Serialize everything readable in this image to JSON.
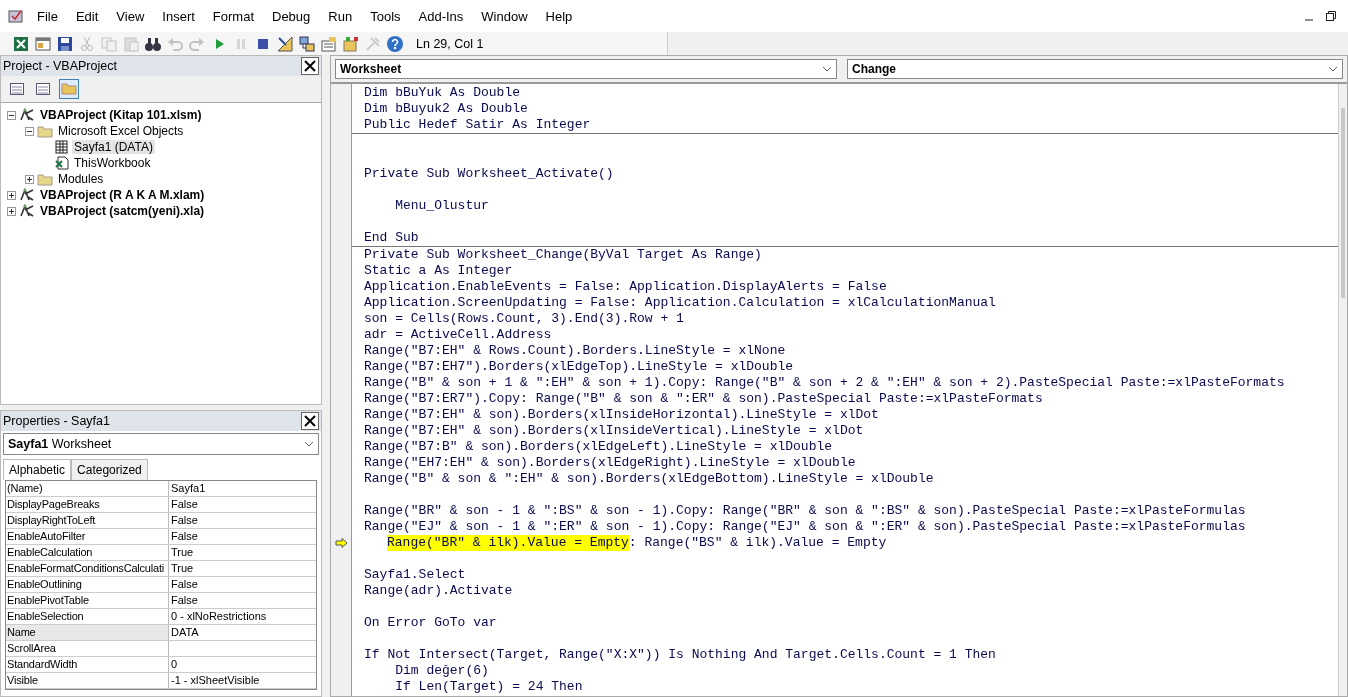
{
  "menu": [
    "File",
    "Edit",
    "View",
    "Insert",
    "Format",
    "Debug",
    "Run",
    "Tools",
    "Add-Ins",
    "Window",
    "Help"
  ],
  "toolbar": [
    {
      "kind": "excel",
      "disabled": false
    },
    {
      "kind": "insert",
      "disabled": false
    },
    {
      "kind": "save",
      "disabled": false
    },
    {
      "kind": "cut",
      "disabled": true
    },
    {
      "kind": "copy",
      "disabled": true
    },
    {
      "kind": "paste",
      "disabled": true
    },
    {
      "kind": "find",
      "disabled": false
    },
    {
      "kind": "undo",
      "disabled": true
    },
    {
      "kind": "redo",
      "disabled": true
    },
    {
      "kind": "run",
      "disabled": false
    },
    {
      "kind": "pause",
      "disabled": true
    },
    {
      "kind": "stop",
      "disabled": false
    },
    {
      "kind": "design",
      "disabled": false
    },
    {
      "kind": "explorer",
      "disabled": false
    },
    {
      "kind": "properties",
      "disabled": false
    },
    {
      "kind": "browser",
      "disabled": false
    },
    {
      "kind": "toolbox",
      "disabled": true
    },
    {
      "kind": "help",
      "disabled": false
    }
  ],
  "status": "Ln 29, Col 1",
  "project": {
    "title": "Project - VBAProject",
    "buttons": [
      {
        "kind": "code",
        "selected": false
      },
      {
        "kind": "object",
        "selected": false
      },
      {
        "kind": "folders",
        "selected": true
      }
    ],
    "tree": [
      {
        "kind": "project",
        "label": "VBAProject (Kitap 101.xlsm)",
        "expanded": true,
        "children": [
          {
            "kind": "folder",
            "label": "Microsoft Excel Objects",
            "expanded": true,
            "children": [
              {
                "kind": "sheet",
                "label": "Sayfa1 (DATA)",
                "selected": true
              },
              {
                "kind": "workbook",
                "label": "ThisWorkbook",
                "selected": false
              }
            ]
          },
          {
            "kind": "folder",
            "label": "Modules",
            "expanded": false
          }
        ]
      },
      {
        "kind": "project",
        "label": "VBAProject (R A K A M.xlam)",
        "expanded": false
      },
      {
        "kind": "project",
        "label": "VBAProject (satcm(yeni).xla)",
        "expanded": false
      }
    ]
  },
  "properties": {
    "title": "Properties - Sayfa1",
    "object": "**Sayfa1** Worksheet",
    "tabs": [
      {
        "label": "Alphabetic",
        "selected": true
      },
      {
        "label": "Categorized",
        "selected": false
      }
    ],
    "rows": [
      {
        "name": "(Name)",
        "value": "Sayfa1",
        "selected": false
      },
      {
        "name": "DisplayPageBreaks",
        "value": "False",
        "selected": false
      },
      {
        "name": "DisplayRightToLeft",
        "value": "False",
        "selected": false
      },
      {
        "name": "EnableAutoFilter",
        "value": "False",
        "selected": false
      },
      {
        "name": "EnableCalculation",
        "value": "True",
        "selected": false
      },
      {
        "name": "EnableFormatConditionsCalculati",
        "value": "True",
        "selected": false
      },
      {
        "name": "EnableOutlining",
        "value": "False",
        "selected": false
      },
      {
        "name": "EnablePivotTable",
        "value": "False",
        "selected": false
      },
      {
        "name": "EnableSelection",
        "value": "0 - xlNoRestrictions",
        "selected": false
      },
      {
        "name": "Name",
        "value": "DATA",
        "selected": true
      },
      {
        "name": "ScrollArea",
        "selected": false
      },
      {
        "name": "StandardWidth",
        "value": "0",
        "selected": false
      },
      {
        "name": "Visible",
        "value": "-1 - xlSheetVisible",
        "selected": false
      }
    ]
  },
  "code": {
    "object": "Worksheet",
    "procedure": "Change",
    "blocks": [
      {
        "lines": [
          {
            "kind": "code",
            "text": "Dim bBuYuk As Double"
          },
          {
            "kind": "code",
            "text": "Dim bBuyuk2 As Double"
          },
          {
            "kind": "code",
            "text": "Public Hedef Satir As Integer"
          }
        ]
      },
      {
        "lines": [
          {
            "kind": "blank"
          },
          {
            "kind": "blank"
          },
          {
            "kind": "code",
            "text": "Private Sub Worksheet_Activate()"
          },
          {
            "kind": "blank"
          },
          {
            "kind": "code",
            "text": "    Menu_Olustur"
          },
          {
            "kind": "blank"
          },
          {
            "kind": "code",
            "text": "End Sub"
          }
        ]
      },
      {
        "lines": [
          {
            "kind": "code",
            "text": "Private Sub Worksheet_Change(ByVal Target As Range)"
          },
          {
            "kind": "code",
            "text": "Static a As Integer"
          },
          {
            "kind": "code",
            "text": "Application.EnableEvents = False: Application.DisplayAlerts = False"
          },
          {
            "kind": "code",
            "text": "Application.ScreenUpdating = False: Application.Calculation = xlCalculationManual"
          },
          {
            "kind": "code",
            "text": "son = Cells(Rows.Count, 3).End(3).Row + 1"
          },
          {
            "kind": "code",
            "text": "adr = ActiveCell.Address"
          },
          {
            "kind": "code",
            "text": "Range(\"B7:EH\" & Rows.Count).Borders.LineStyle = xlNone"
          },
          {
            "kind": "code",
            "text": "Range(\"B7:EH7\").Borders(xlEdgeTop).LineStyle = xlDouble"
          },
          {
            "kind": "code",
            "text": "Range(\"B\" & son + 1 & \":EH\" & son + 1).Copy: Range(\"B\" & son + 2 & \":EH\" & son + 2).PasteSpecial Paste:=xlPasteFormats"
          },
          {
            "kind": "code",
            "text": "Range(\"B7:ER7\").Copy: Range(\"B\" & son & \":ER\" & son).PasteSpecial Paste:=xlPasteFormats"
          },
          {
            "kind": "code",
            "text": "Range(\"B7:EH\" & son).Borders(xlInsideHorizontal).LineStyle = xlDot"
          },
          {
            "kind": "code",
            "text": "Range(\"B7:EH\" & son).Borders(xlInsideVertical).LineStyle = xlDot"
          },
          {
            "kind": "code",
            "text": "Range(\"B7:B\" & son).Borders(xlEdgeLeft).LineStyle = xlDouble"
          },
          {
            "kind": "code",
            "text": "Range(\"EH7:EH\" & son).Borders(xlEdgeRight).LineStyle = xlDouble"
          },
          {
            "kind": "code",
            "text": "Range(\"B\" & son & \":EH\" & son).Borders(xlEdgeBottom).LineStyle = xlDouble"
          },
          {
            "kind": "blank"
          },
          {
            "kind": "code",
            "text": "Range(\"BR\" & son - 1 & \":BS\" & son - 1).Copy: Range(\"BR\" & son & \":BS\" & son).PasteSpecial Paste:=xlPasteFormulas"
          },
          {
            "kind": "code",
            "text": "Range(\"EJ\" & son - 1 & \":ER\" & son - 1).Copy: Range(\"EJ\" & son & \":ER\" & son).PasteSpecial Paste:=xlPasteFormulas"
          },
          {
            "kind": "current",
            "highlighted": "Range(\"BR\" & ilk).Value = Empty",
            "rest": ": Range(\"BS\" & ilk).Value = Empty"
          },
          {
            "kind": "blank"
          },
          {
            "kind": "code",
            "text": "Sayfa1.Select"
          },
          {
            "kind": "code",
            "text": "Range(adr).Activate"
          },
          {
            "kind": "blank"
          },
          {
            "kind": "code",
            "text": "On Error GoTo var"
          },
          {
            "kind": "blank"
          },
          {
            "kind": "code",
            "text": "If Not Intersect(Target, Range(\"X:X\")) Is Nothing And Target.Cells.Count = 1 Then"
          },
          {
            "kind": "code",
            "text": "    Dim değer(6)"
          },
          {
            "kind": "code",
            "text": "    If Len(Target) = 24 Then"
          }
        ]
      }
    ]
  }
}
